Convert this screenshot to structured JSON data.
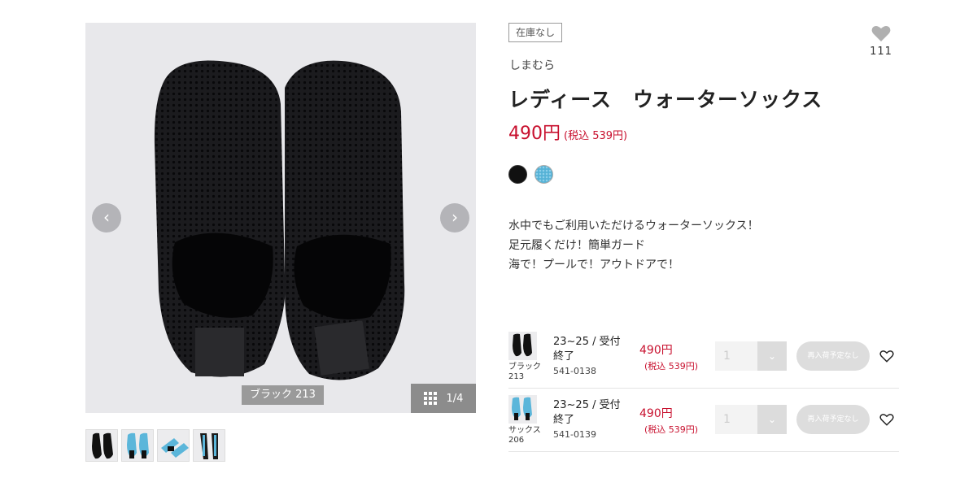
{
  "gallery": {
    "caption": "ブラック 213",
    "counter": "1/4",
    "prev": "‹",
    "next": "›"
  },
  "product": {
    "stock_badge": "在庫なし",
    "favorite_count": "111",
    "brand": "しまむら",
    "title": "レディース　ウォーターソックス",
    "price": "490円",
    "price_tax": "(税込 539円)",
    "colors": {
      "black": "#111111",
      "blue": "#55b2d6",
      "accent": "#c8102e"
    },
    "description": [
      "水中でもご利用いただけるウォーターソックス！",
      "足元履くだけ！簡単ガード",
      "海で！プールで！アウトドアで！"
    ]
  },
  "variants": [
    {
      "color_name": "ブラック",
      "color_code": "213",
      "size_status": "23~25 / 受付終了",
      "sku": "541-0138",
      "price": "490円",
      "price_tax": "(税込 539円)",
      "qty": "1",
      "restock": "再入荷予定なし"
    },
    {
      "color_name": "サックス",
      "color_code": "206",
      "size_status": "23~25 / 受付終了",
      "sku": "541-0139",
      "price": "490円",
      "price_tax": "(税込 539円)",
      "qty": "1",
      "restock": "再入荷予定なし"
    }
  ]
}
